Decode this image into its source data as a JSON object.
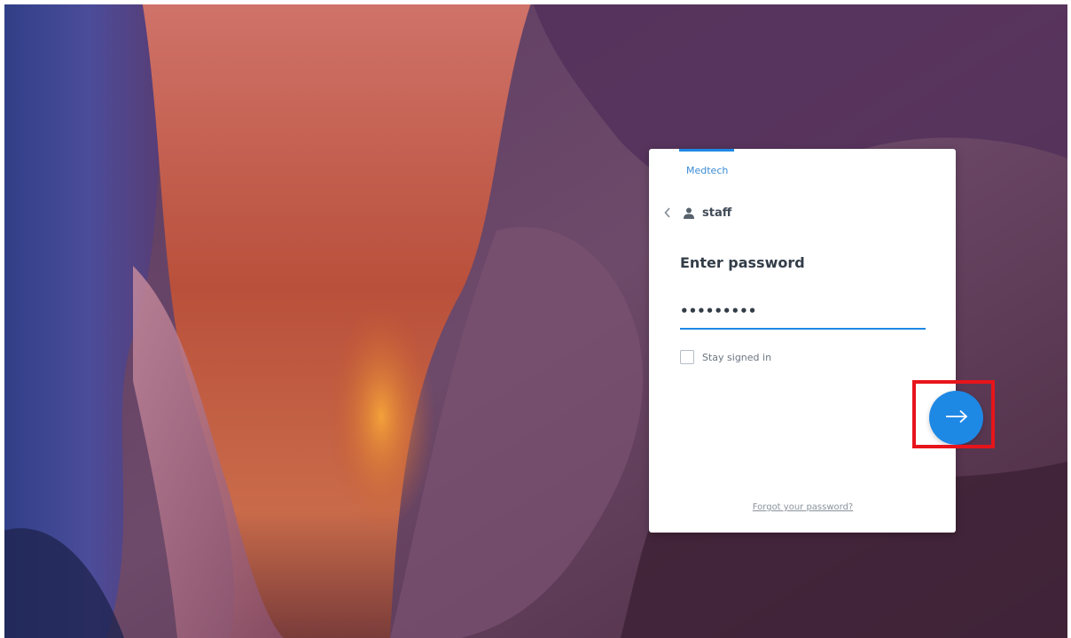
{
  "login": {
    "brand": "Medtech",
    "username": "staff",
    "heading": "Enter password",
    "password_value": "•••••••••",
    "stay_signed_in_label": "Stay signed in",
    "forgot_password_label": "Forgot your password?"
  },
  "icons": {
    "back": "chevron-left-icon",
    "user": "user-icon",
    "submit": "arrow-right-icon"
  },
  "colors": {
    "accent": "#1e88e5",
    "highlight": "#e8141b",
    "card": "#ffffff"
  }
}
